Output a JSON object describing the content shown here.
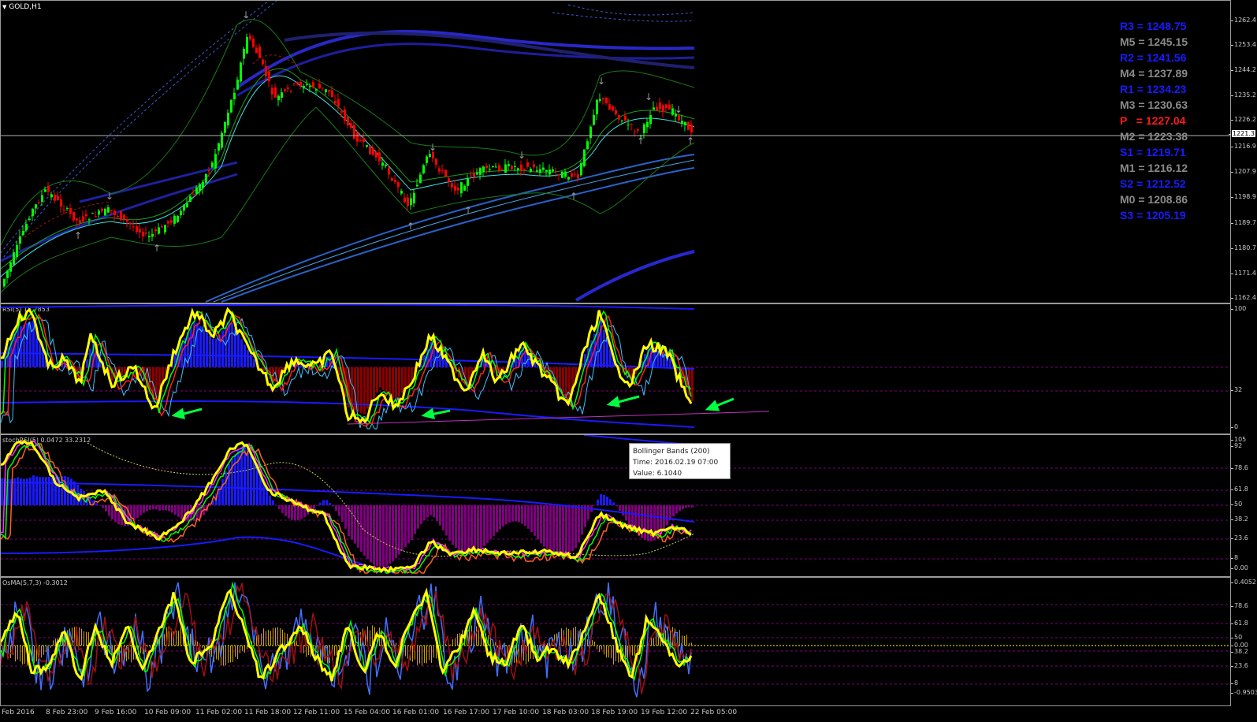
{
  "main": {
    "symbol": "GOLD,H1",
    "price_scale": [
      "1262.4",
      "1253.4",
      "1244.2",
      "1235.2",
      "1226.2",
      "1216.9",
      "1207.9",
      "1198.9",
      "1189.7",
      "1180.7",
      "1171.4",
      "1162.4"
    ],
    "current_price": "1221.3",
    "pivots": [
      {
        "label": "R3 = 1248.75",
        "color": "#1a1aff"
      },
      {
        "label": "M5 = 1245.15",
        "color": "#8a8a8a"
      },
      {
        "label": "R2 = 1241.56",
        "color": "#1a1aff"
      },
      {
        "label": "M4 = 1237.89",
        "color": "#8a8a8a"
      },
      {
        "label": "R1 = 1234.23",
        "color": "#1a1aff"
      },
      {
        "label": "M3 = 1230.63",
        "color": "#8a8a8a"
      },
      {
        "label": "P   = 1227.04",
        "color": "#ff1a1a"
      },
      {
        "label": "M2 = 1223.38",
        "color": "#8a8a8a"
      },
      {
        "label": "S1 = 1219.71",
        "color": "#1a1aff"
      },
      {
        "label": "M1 = 1216.12",
        "color": "#8a8a8a"
      },
      {
        "label": "S2 = 1212.52",
        "color": "#1a1aff"
      },
      {
        "label": "M0 = 1208.86",
        "color": "#8a8a8a"
      },
      {
        "label": "S3 = 1205.19",
        "color": "#1a1aff"
      }
    ]
  },
  "rsi": {
    "label": "RSI(5) 15.7853",
    "scale": [
      "100",
      "32",
      "0"
    ]
  },
  "stoch": {
    "label": "stochRSI(5) 0.0472 33.2312",
    "scale": [
      "105",
      "92",
      "78.6",
      "61.8",
      "50",
      "38.2",
      "23.6",
      "8",
      "0.00"
    ]
  },
  "osma": {
    "label": "OsMA(5,7,3) -0.3012",
    "scale": [
      "0.4052",
      "78.6",
      "61.8",
      "50",
      "0.00",
      "38.2",
      "23.6",
      "8",
      "-0.9503"
    ]
  },
  "tooltip": {
    "name": "Bollinger Bands (200)",
    "time": "Time: 2016.02.19 07:00",
    "value": "Value: 6.1040"
  },
  "time_axis": [
    "Feb 2016",
    "8 Feb 23:00",
    "9 Feb 16:00",
    "10 Feb 09:00",
    "11 Feb 02:00",
    "11 Feb 18:00",
    "12 Feb 11:00",
    "15 Feb 04:00",
    "16 Feb 01:00",
    "16 Feb 17:00",
    "17 Feb 10:00",
    "18 Feb 03:00",
    "18 Feb 19:00",
    "19 Feb 12:00",
    "22 Feb 05:00"
  ],
  "colors": {
    "bull_candle": "#00ff00",
    "bear_candle": "#ff0000",
    "rsi_line": "#ffff00",
    "hist_blue": "#1a1aff",
    "hist_red": "#8b0000",
    "hist_purple": "#800080",
    "arrow_green": "#00ff40"
  }
}
